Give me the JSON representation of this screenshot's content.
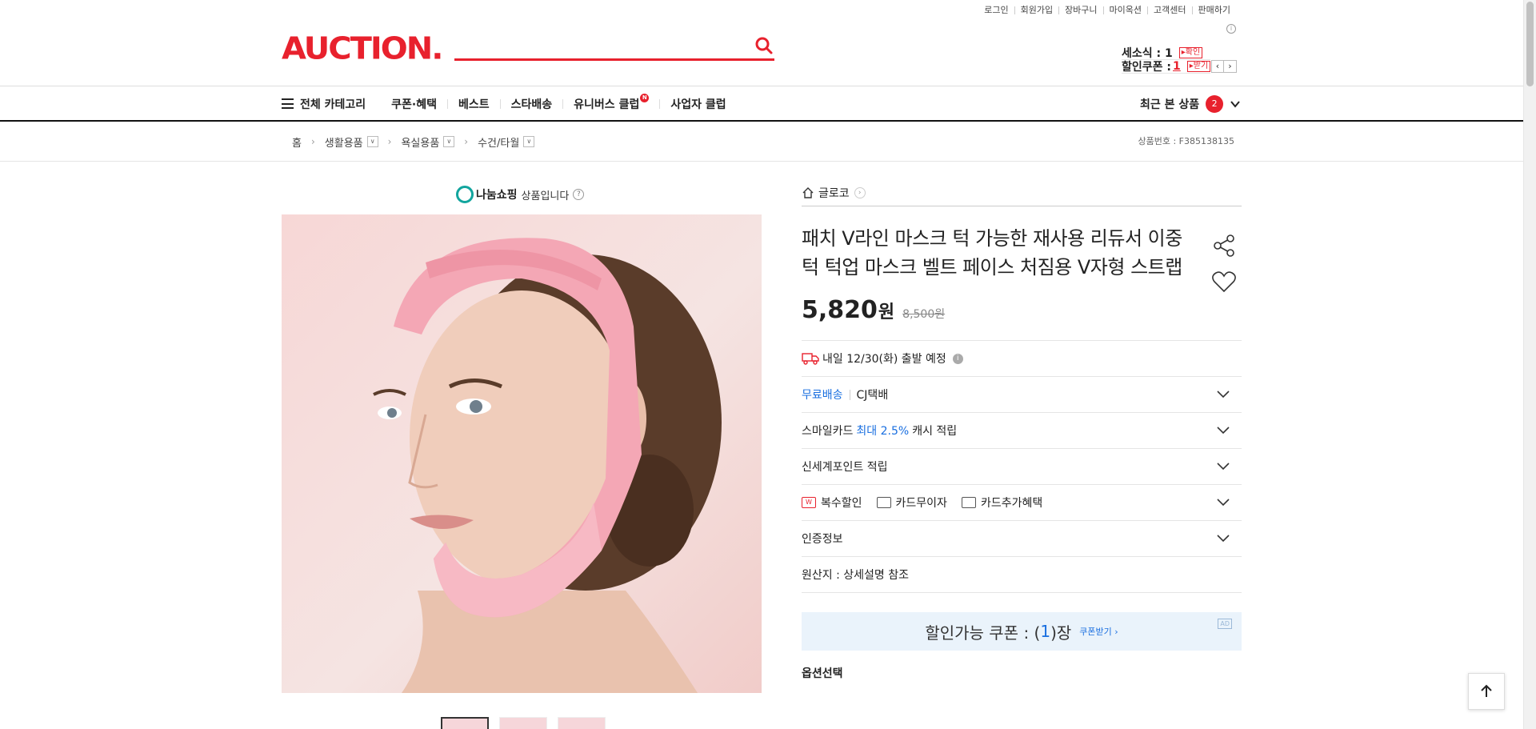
{
  "utility": {
    "links": [
      "로그인",
      "회원가입",
      "장바구니",
      "마이옥션",
      "고객센터",
      "판매하기"
    ],
    "info_icon": "info-circle-icon"
  },
  "header": {
    "logo": "AUCTION.",
    "search": {
      "value": "",
      "placeholder": ""
    },
    "mini": {
      "recent_label": "세소식 : 1",
      "recent_tag": "확인",
      "coupon_label": "할인쿠폰 :",
      "coupon_count": "1",
      "coupon_tag": "받기"
    }
  },
  "gnb": {
    "all_category": "전체 카테고리",
    "items": [
      "쿠폰·혜택",
      "베스트",
      "스타배송",
      "유니버스 클럽",
      "사업자 클럽"
    ],
    "universe_badge": "N",
    "recent_label": "최근 본 상품",
    "recent_count": "2"
  },
  "breadcrumb": {
    "items": [
      "홈",
      "생활용품",
      "욕실용품",
      "수건/타월"
    ],
    "product_no": "상품번호 : F385138135"
  },
  "gallery": {
    "nanum_logo": "나눔쇼핑",
    "nanum_text": "상품입니다",
    "thumb_count": 3
  },
  "product": {
    "store": "글로코",
    "title": "패치 V라인 마스크 턱 가능한 재사용 리듀서 이중턱 턱업 마스크 벨트 페이스 처짐용 V자형 스트랩",
    "price": "5,820",
    "price_unit": "원",
    "original_price": "8,500원",
    "shipping_date": "내일 12/30(화) 출발 예정",
    "delivery_free": "무료배송",
    "delivery_company": "CJ택배",
    "smilecard_prefix": "스마일카드",
    "smilecard_highlight": "최대 2.5%",
    "smilecard_suffix": "캐시 적립",
    "ssg_point": "신세계포인트 적립",
    "benefits": [
      "복수할인",
      "카드무이자",
      "카드추가혜택"
    ],
    "certification": "인증정보",
    "origin": "원산지 : 상세설명 참조",
    "coupon_prefix": "할인가능 쿠폰 : (",
    "coupon_count": "1",
    "coupon_suffix": ")장",
    "coupon_get": "쿠폰받기 ›",
    "coupon_ad": "AD",
    "options_title": "옵션선택"
  },
  "colors": {
    "brand": "#e8212d",
    "link_blue": "#1a6fe0",
    "coupon_bg": "#eaf3fb"
  }
}
